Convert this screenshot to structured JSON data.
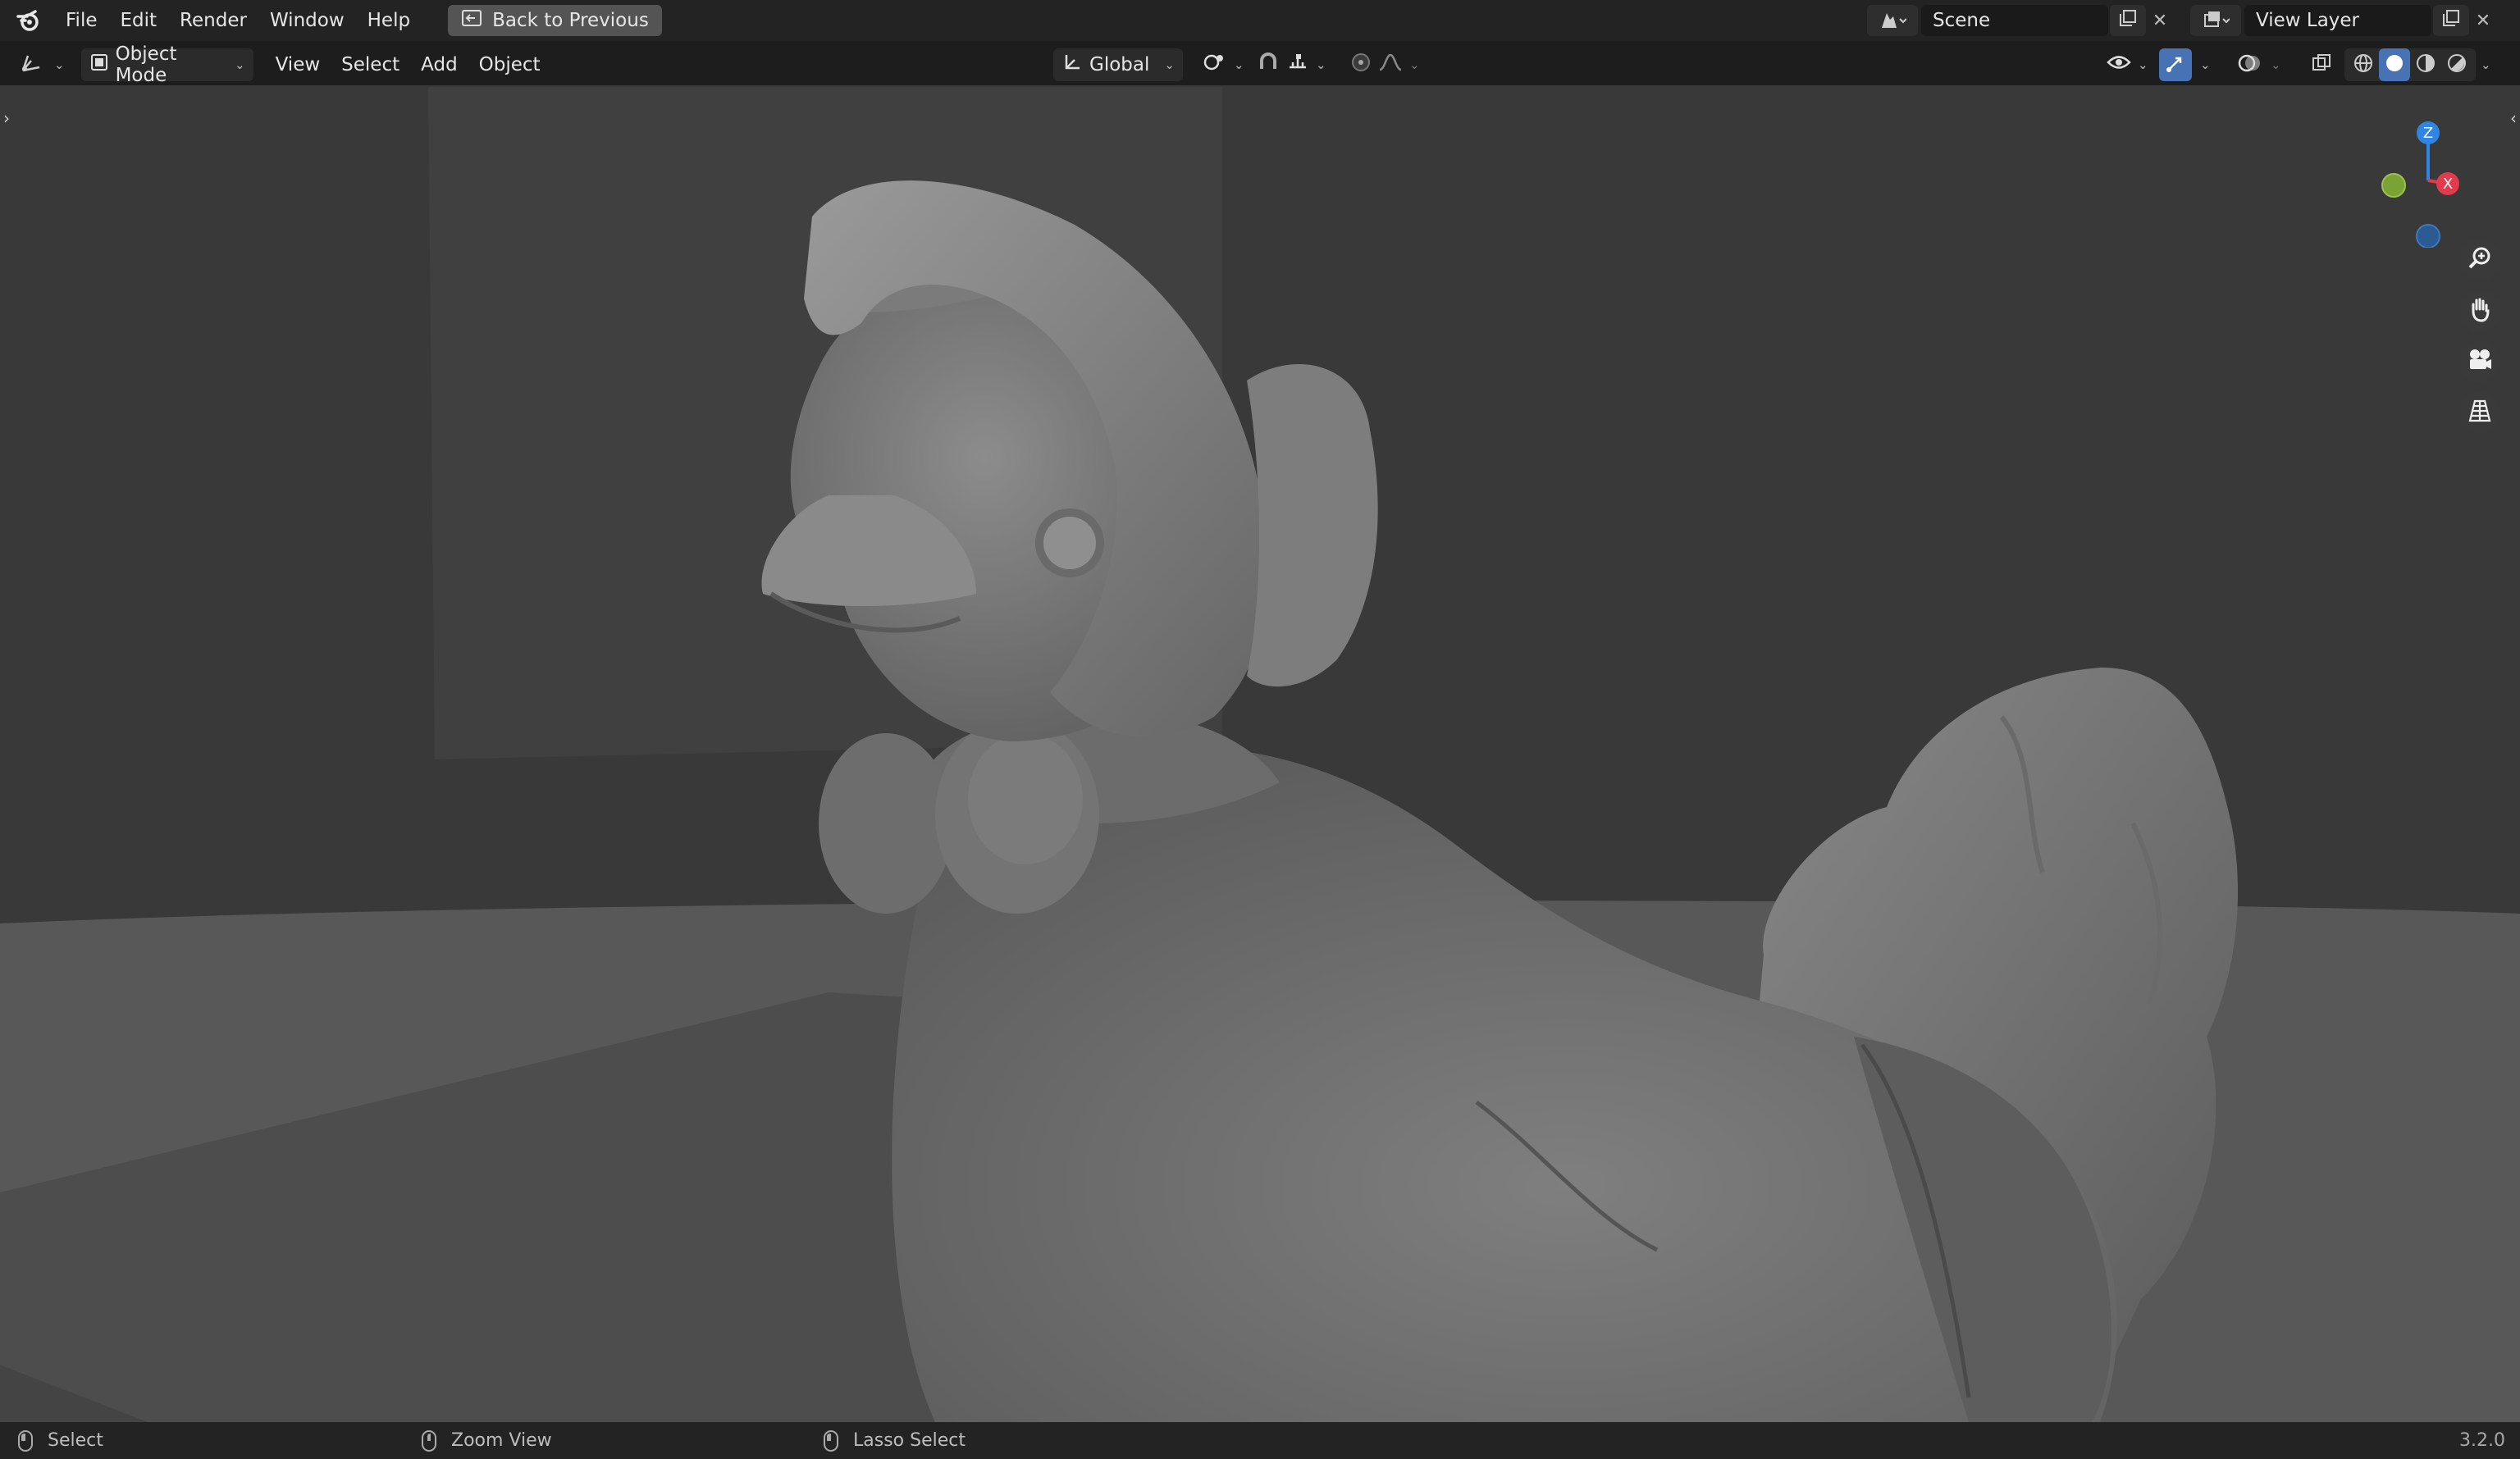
{
  "topbar": {
    "logo_icon": "blender-logo-icon",
    "menus": [
      "File",
      "Edit",
      "Render",
      "Window",
      "Help"
    ],
    "back_button": "Back to Previous",
    "scene_name": "Scene",
    "view_layer_name": "View Layer"
  },
  "header": {
    "editor_type_icon": "view3d-editor-icon",
    "mode": "Object Mode",
    "menus": [
      "View",
      "Select",
      "Add",
      "Object"
    ],
    "transform_orientation": "Global",
    "pivot_icon": "pivot-point-icon",
    "snap_icon": "magnet-snap-icon",
    "proportional_icon": "proportional-editing-icon",
    "viewport_shading_active": "solid"
  },
  "viewport": {
    "gizmo_axes": [
      "Z",
      "X",
      "Y"
    ],
    "axis_colors": {
      "x": "#e23b4e",
      "y": "#7ba235",
      "z": "#2f85e3"
    },
    "nav_tools": [
      "zoom-icon",
      "pan-hand-icon",
      "camera-view-icon",
      "perspective-grid-icon"
    ]
  },
  "statusbar": {
    "select": "Select",
    "zoom_view": "Zoom View",
    "lasso_select": "Lasso Select",
    "version": "3.2.0"
  }
}
